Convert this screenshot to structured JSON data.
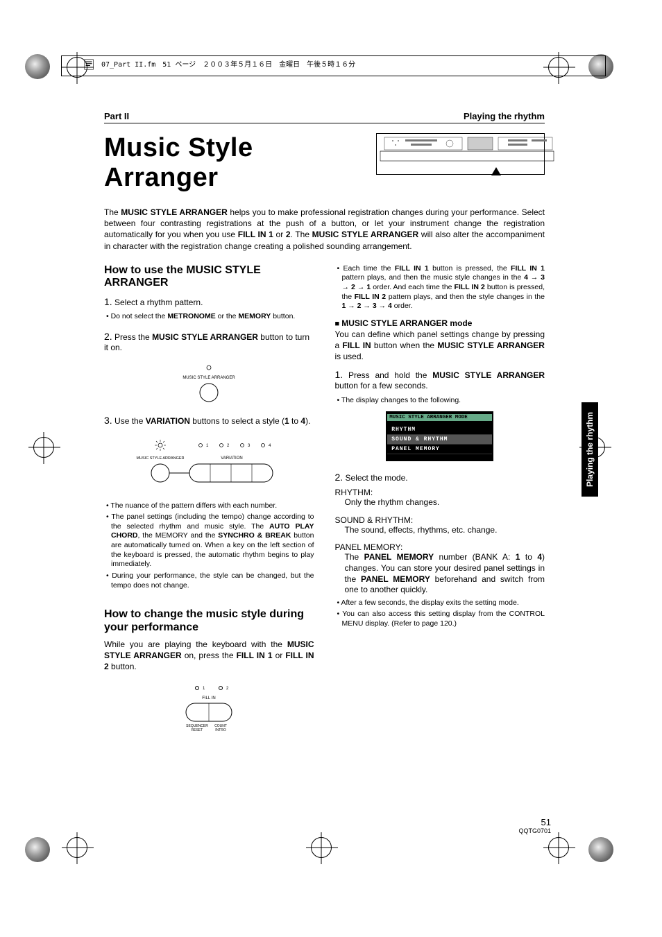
{
  "slug": "07_Part II.fm　51 ページ　２００３年５月１６日　金曜日　午後５時１６分",
  "header": {
    "part": "Part II",
    "section": "Playing the rhythm"
  },
  "title": "Music Style Arranger",
  "intro_segments": [
    "The ",
    "MUSIC STYLE ARRANGER",
    " helps you to make professional registration changes during your performance. Select between four contrasting registrations at the push of a button, or let your instrument change the registration automatically for you when you use ",
    "FILL IN 1",
    " or ",
    "2",
    ". The ",
    "MUSIC STYLE ARRANGER",
    " will also alter the accompaniment in character with the registration change creating a polished sounding arrangement."
  ],
  "left": {
    "h2a": "How to use the MUSIC STYLE ARRANGER",
    "step1": "Select a rhythm pattern.",
    "step1_bullet_parts": [
      "Do not select the ",
      "METRONOME",
      " or the ",
      "MEMORY",
      " button."
    ],
    "step2_parts": [
      "Press the ",
      "MUSIC STYLE ARRANGER",
      " button to turn it on."
    ],
    "fig1_label": "MUSIC STYLE ARRANGER",
    "step3_parts": [
      "Use the ",
      "VARIATION",
      " buttons to select a style (",
      "1",
      " to ",
      "4",
      ")."
    ],
    "fig2_labels": {
      "msa": "MUSIC STYLE ARRANGER",
      "variation": "VARIATION",
      "nums": [
        "1",
        "2",
        "3",
        "4"
      ]
    },
    "bullets_after_fig2": [
      "The nuance of the pattern differs with each number.",
      [
        "The panel settings (including the tempo) change according to the selected rhythm and music style. The ",
        "AUTO PLAY CHORD",
        ", the MEMORY and the ",
        "SYNCHRO & BREAK",
        " button are automatically turned on. When a key on the left section of the keyboard is pressed, the automatic rhythm begins to play immediately."
      ],
      "During your performance, the style can be changed, but the tempo does not change."
    ],
    "h2b": "How to change the music style during your performance",
    "change_para_parts": [
      "While you are playing the keyboard with the ",
      "MUSIC STYLE ARRANGER",
      " on, press the ",
      "FILL IN 1",
      " or ",
      "FILL IN 2",
      " button."
    ],
    "fig3_labels": {
      "fillin": "FILL IN",
      "nums": [
        "1",
        "2"
      ],
      "seq": "SEQUENCER\nRESET",
      "count": "COUNT\nINTRO"
    }
  },
  "right": {
    "top_bullet_parts": [
      "Each time the ",
      "FILL IN 1",
      " button is pressed, the ",
      "FILL IN 1",
      " pattern plays, and then the music style changes in the ",
      "4 → 3 → 2 → 1",
      " order. And each time the ",
      "FILL IN 2",
      " button is pressed, the ",
      "FILL IN 2",
      " pattern plays, and then the style changes in the ",
      "1 → 2 → 3 → 4",
      " order."
    ],
    "mode_heading": "MUSIC STYLE ARRANGER mode",
    "mode_para_parts": [
      "You can define which panel settings change by pressing a ",
      "FILL IN",
      " button when the ",
      "MUSIC STYLE ARRANGER",
      " is used."
    ],
    "mode_step1_parts": [
      "Press and hold the ",
      "MUSIC STYLE ARRANGER",
      " button for a few seconds."
    ],
    "mode_step1_bullet": "The display changes to the following.",
    "screen": {
      "title": "MUSIC STYLE ARRANGER MODE",
      "rows": [
        "RHYTHM",
        "SOUND & RHYTHM",
        "PANEL MEMORY"
      ]
    },
    "mode_step2": "Select the mode.",
    "modes": [
      {
        "label": "RHYTHM:",
        "desc": "Only the rhythm changes."
      },
      {
        "label": "SOUND & RHYTHM:",
        "desc": "The sound, effects, rhythms, etc. change."
      },
      {
        "label": "PANEL MEMORY:",
        "desc_parts": [
          "The ",
          "PANEL MEMORY",
          " number (BANK A: ",
          "1",
          " to ",
          "4",
          ") changes. You can store your desired panel settings in the ",
          "PANEL MEMORY",
          " beforehand and switch from one to another quickly."
        ]
      }
    ],
    "tail_bullets": [
      "After a few seconds, the display exits the setting mode.",
      "You can also access this setting display from the CONTROL MENU display. (Refer to page 120.)"
    ]
  },
  "side_tab": "Playing the rhythm",
  "page_number": "51",
  "doc_id": "QQTG0701"
}
